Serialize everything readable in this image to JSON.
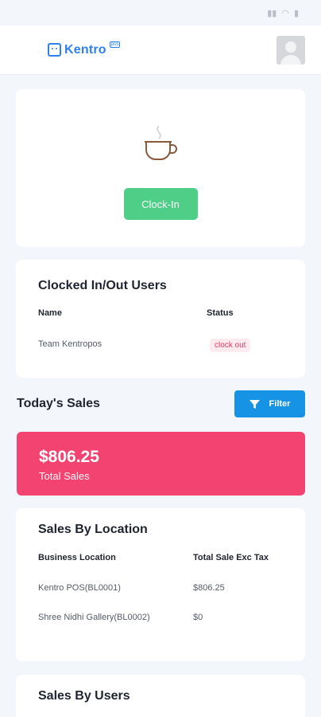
{
  "status_bar": {
    "time": "",
    "icons": [
      "signal-icon",
      "wifi-icon",
      "battery-icon"
    ]
  },
  "header": {
    "logo_text": "Kentro",
    "logo_sup": "pos"
  },
  "clock": {
    "button_label": "Clock-In"
  },
  "clocked_users": {
    "title": "Clocked In/Out Users",
    "headers": {
      "name": "Name",
      "status": "Status"
    },
    "rows": [
      {
        "name": "Team Kentropos",
        "status": "clock out"
      }
    ]
  },
  "todays_sales": {
    "title": "Today's Sales",
    "filter_label": "Filter"
  },
  "total_sales": {
    "value": "$806.25",
    "label": "Total Sales"
  },
  "sales_by_location": {
    "title": "Sales By Location",
    "headers": {
      "location": "Business Location",
      "total": "Total Sale Exc Tax"
    },
    "rows": [
      {
        "location": "Kentro POS(BL0001)",
        "total": "$806.25"
      },
      {
        "location": "Shree Nidhi Gallery(BL0002)",
        "total": "$0"
      }
    ]
  },
  "sales_by_users": {
    "title": "Sales By Users"
  },
  "colors": {
    "accent": "#2f80ed",
    "clock_button": "#4fce88",
    "total_card": "#f34471",
    "filter_button": "#1793e6",
    "badge_text": "#e53962"
  }
}
